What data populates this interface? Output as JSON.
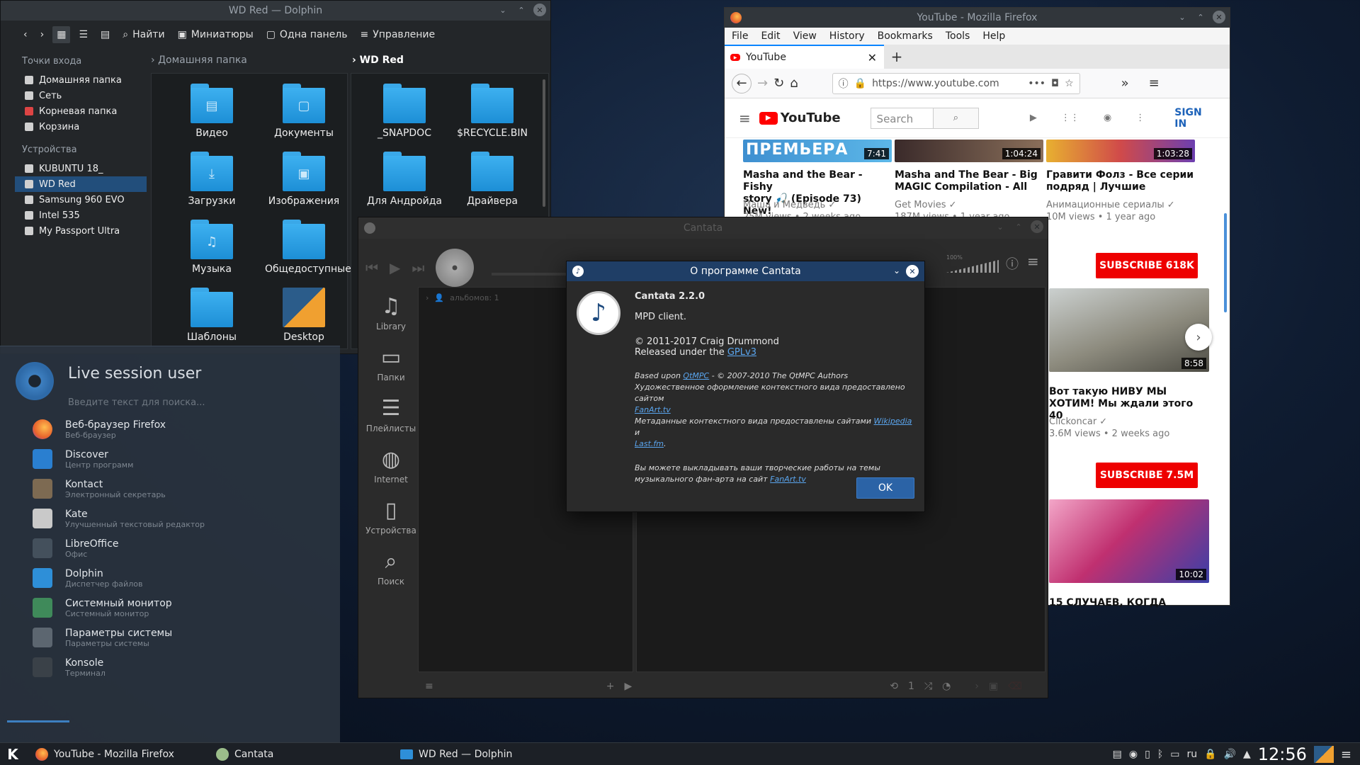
{
  "dolphin": {
    "title": "WD Red — Dolphin",
    "toolbar": {
      "find": "Найти",
      "thumbs": "Миниатюры",
      "one_pane": "Одна панель",
      "manage": "Управление"
    },
    "places_heading": "Точки входа",
    "places": [
      "Домашняя папка",
      "Сеть",
      "Корневая папка",
      "Корзина"
    ],
    "devices_heading": "Устройства",
    "devices": [
      "KUBUNTU 18_",
      "WD Red",
      "Samsung 960 EVO",
      "Intel 535",
      "My Passport Ultra"
    ],
    "left_crumb": "Домашняя папка",
    "right_crumb": "WD Red",
    "left_items": [
      "Видео",
      "Документы",
      "Загрузки",
      "Изображения",
      "Музыка",
      "Общедоступные",
      "Шаблоны",
      "Desktop"
    ],
    "right_items": [
      "_SNAPDOC",
      "$RECYCLE.BIN",
      "Для Андройда",
      "Драйвера"
    ]
  },
  "firefox": {
    "title": "YouTube - Mozilla Firefox",
    "menu": [
      "File",
      "Edit",
      "View",
      "History",
      "Bookmarks",
      "Tools",
      "Help"
    ],
    "tab_label": "YouTube",
    "url": "https://www.youtube.com",
    "yt": {
      "logo": "YouTube",
      "search_placeholder": "Search",
      "sign_in": "SIGN IN"
    },
    "videos": [
      {
        "duration": "7:41",
        "title1": "Masha and the Bear - Fishy",
        "title2": "story 🎣 (Episode 73) New!",
        "channel": "Маша и Медведь ✓",
        "meta": "25M views • 2 weeks ago",
        "thumb_text": "ПРЕМЬЕРА"
      },
      {
        "duration": "1:04:24",
        "title1": "Masha and The Bear - Big",
        "title2": "MAGIC Compilation - All",
        "channel": "Get Movies ✓",
        "meta": "187M views • 1 year ago"
      },
      {
        "duration": "1:03:28",
        "title1": "Гравити Фолз - Все серии",
        "title2": "подряд | Лучшие",
        "channel": "Анимационные сериалы ✓",
        "meta": "10M views • 1 year ago"
      }
    ],
    "subscribe1": "SUBSCRIBE 618K",
    "video4": {
      "duration": "8:58",
      "title1": "Вот такую НИВУ МЫ",
      "title2": "ХОТИМ! Мы ждали этого 40",
      "channel": "Clickoncar ✓",
      "meta": "3.6M views • 2 weeks ago"
    },
    "subscribe2": "SUBSCRIBE 7.5M",
    "video5": {
      "duration": "10:02",
      "title1": "15 СЛУЧАЕВ, КОГДА"
    }
  },
  "cantata": {
    "title": "Cantata",
    "nav": [
      "Library",
      "Папки",
      "Плейлисты",
      "Internet",
      "Устройства",
      "Поиск"
    ],
    "albums_text": "альбомов: 1",
    "volume_pct": "100%"
  },
  "about": {
    "title": "О программе Cantata",
    "app": "Cantata 2.2.0",
    "desc": "MPD client.",
    "copyright": "© 2011-2017 Craig Drummond",
    "license_prefix": "Released under the",
    "license": "GPLv3",
    "based_prefix": "Based upon",
    "based_link": "QtMPC",
    "based_suffix": "- © 2007-2010 The QtMPC Authors",
    "art_line": "Художественное оформление контекстного вида предоставлено сайтом",
    "fanart": "FanArt.tv",
    "meta_line": "Метаданные контекстного вида предоставлены сайтами",
    "wikipedia": "Wikipedia",
    "and": "и",
    "lastfm": "Last.fm",
    "upload_line1": "Вы можете выкладывать ваши творческие работы на темы",
    "upload_line2": "музыкального фан-арта на сайт",
    "ok": "OK"
  },
  "launcher": {
    "user": "Live session user",
    "search_placeholder": "Введите текст для поиска...",
    "apps": [
      {
        "name": "Веб-браузер Firefox",
        "desc": "Веб-браузер",
        "color": "#e8642c"
      },
      {
        "name": "Discover",
        "desc": "Центр программ",
        "color": "#2a7fd0"
      },
      {
        "name": "Kontact",
        "desc": "Электронный секретарь",
        "color": "#7d6a52"
      },
      {
        "name": "Kate",
        "desc": "Улучшенный текстовый редактор",
        "color": "#c9c9c9"
      },
      {
        "name": "LibreOffice",
        "desc": "Офис",
        "color": "#44505c"
      },
      {
        "name": "Dolphin",
        "desc": "Диспетчер файлов",
        "color": "#2e8fd8"
      },
      {
        "name": "Системный монитор",
        "desc": "Системный монитор",
        "color": "#3f8a5a"
      },
      {
        "name": "Параметры системы",
        "desc": "Параметры системы",
        "color": "#5c6670"
      },
      {
        "name": "Konsole",
        "desc": "Терминал",
        "color": "#3a4148"
      }
    ]
  },
  "taskbar": {
    "tasks": [
      "YouTube - Mozilla Firefox",
      "Cantata",
      "WD Red — Dolphin"
    ],
    "lang": "ru",
    "clock": "12:56"
  }
}
